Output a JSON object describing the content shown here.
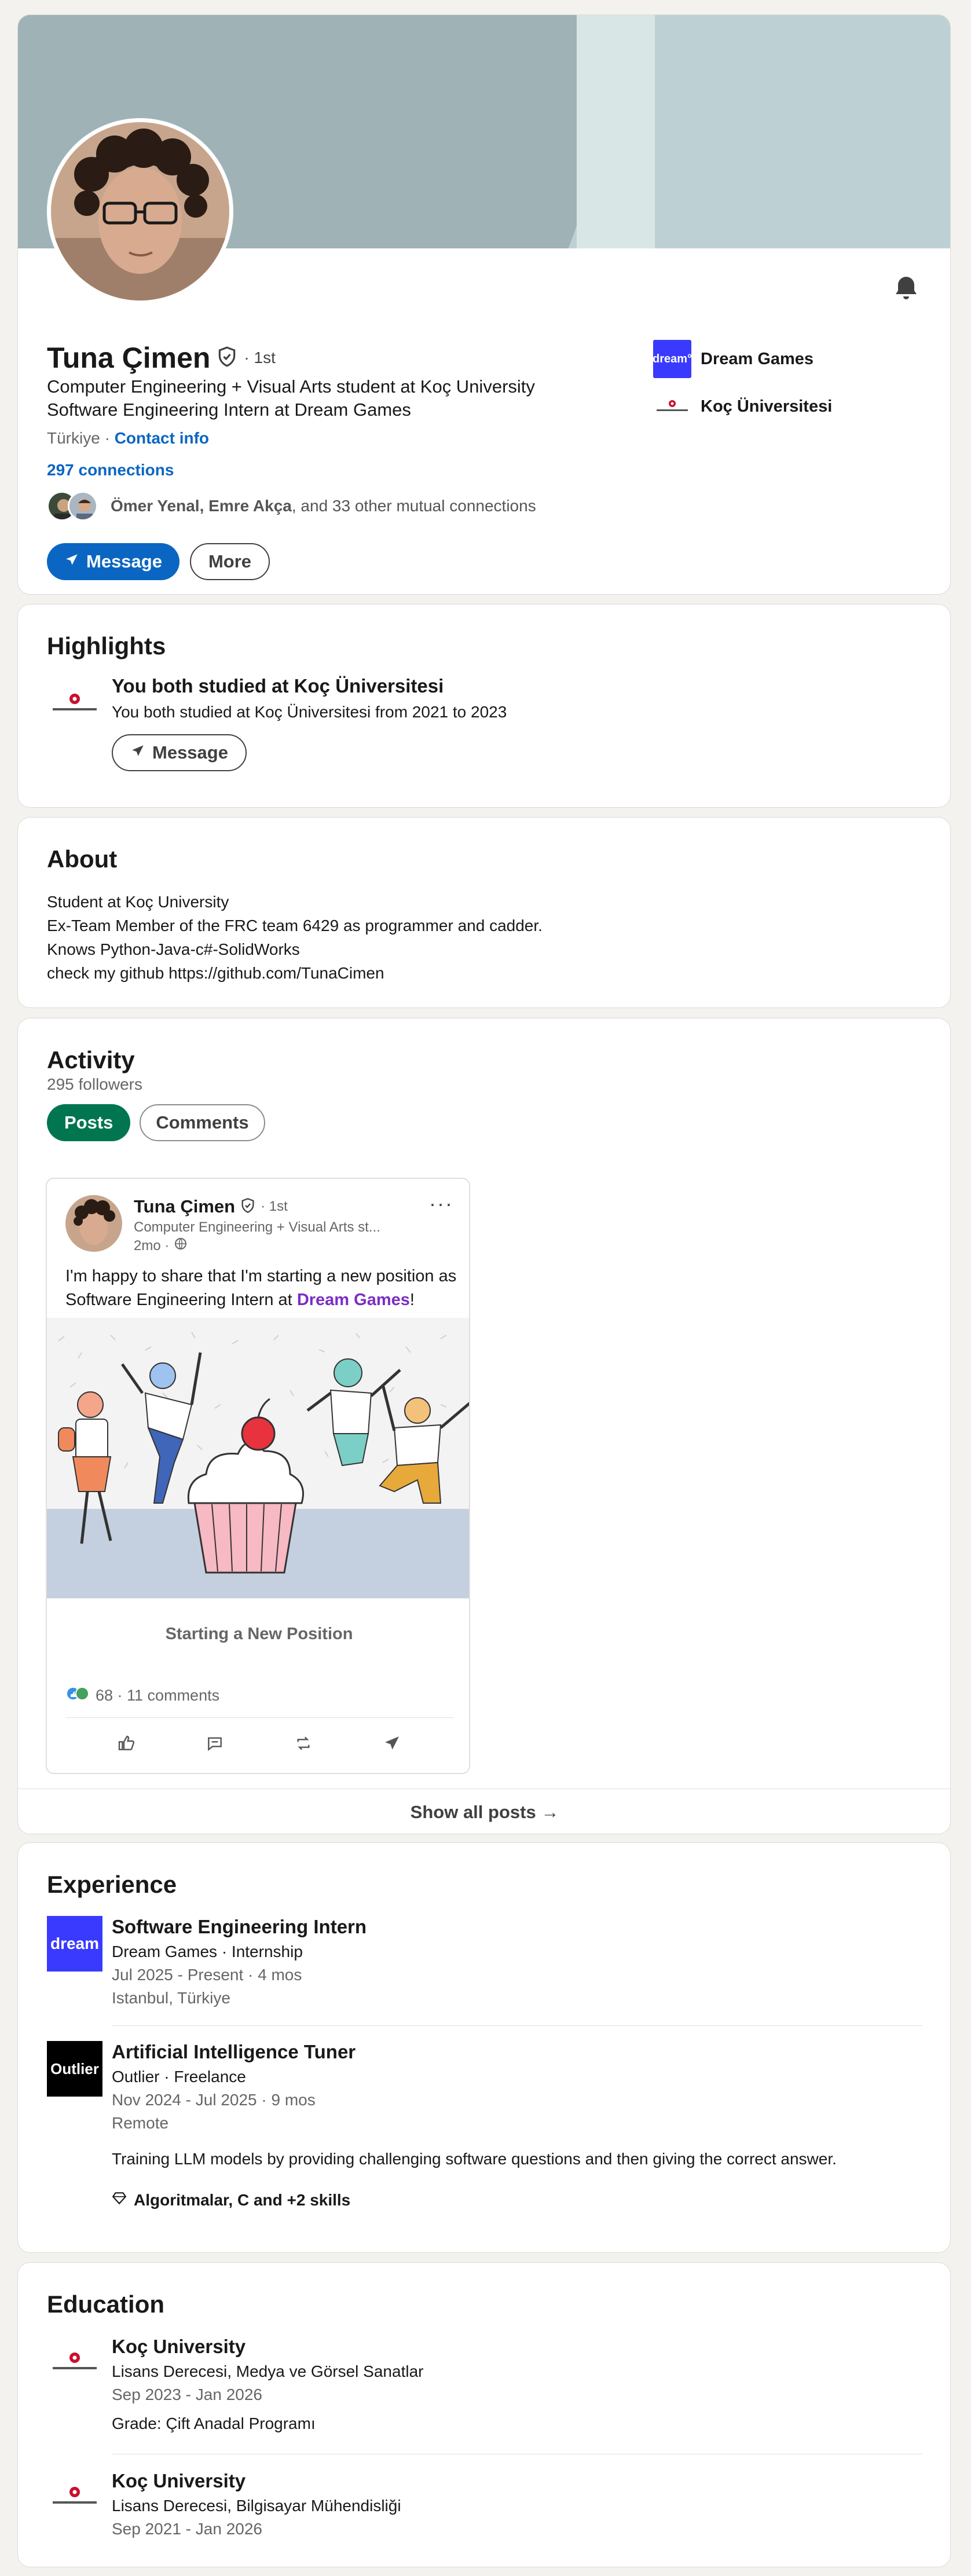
{
  "profile": {
    "name": "Tuna Çimen",
    "degree": "· 1st",
    "headline_line1": "Computer Engineering + Visual Arts student at Koç University",
    "headline_line2": "Software Engineering Intern at Dream Games",
    "location": "Türkiye ·",
    "contact_info": "Contact info",
    "connections": "297 connections",
    "mutual_name1": "Ömer Yenal",
    "mutual_sep": ",",
    "mutual_name2": "Emre Akça",
    "mutual_rest": ", and 33 other mutual connections",
    "message_btn": "Message",
    "more_btn": "More"
  },
  "companies": [
    {
      "logo": "dream",
      "name": "Dream Games"
    },
    {
      "logo": "koc",
      "name": "Koç Üniversitesi"
    }
  ],
  "highlights": {
    "title": "Highlights",
    "item_title": "You both studied at Koç Üniversitesi",
    "item_sub": "You both studied at Koç Üniversitesi from 2021 to 2023",
    "button": "Message"
  },
  "about": {
    "title": "About",
    "lines": [
      "Student at Koç University",
      "Ex-Team Member of the FRC team 6429 as programmer and cadder.",
      "Knows Python-Java-c#-SolidWorks",
      "check my github https://github.com/TunaCimen"
    ]
  },
  "activity": {
    "title": "Activity",
    "followers": "295 followers",
    "tab_posts": "Posts",
    "tab_comments": "Comments",
    "post": {
      "author": "Tuna Çimen",
      "degree": "· 1st",
      "headline": "Computer Engineering + Visual Arts st...",
      "time": "2mo ·",
      "text_before": "I'm happy to share that I'm starting a new position as Software Engineering Intern at ",
      "mention": "Dream Games",
      "text_after": "!",
      "caption": "Starting a New Position",
      "reactions": "68 · 11 comments"
    },
    "show_all": "Show all posts →"
  },
  "experience": {
    "title": "Experience",
    "items": [
      {
        "logo_text": "dream",
        "title": "Software Engineering Intern",
        "company": "Dream Games · Internship",
        "dates": "Jul 2025 - Present · 4 mos",
        "location": "Istanbul, Türkiye"
      },
      {
        "logo_text": "Outlier",
        "title": "Artificial Intelligence Tuner",
        "company": "Outlier · Freelance",
        "dates": "Nov 2024 - Jul 2025 · 9 mos",
        "location": "Remote",
        "description": "Training LLM models by providing challenging software questions and then giving the correct answer.",
        "skills": "Algoritmalar, C and +2 skills"
      }
    ]
  },
  "education": {
    "title": "Education",
    "items": [
      {
        "school": "Koç University",
        "degree": "Lisans Derecesi, Medya ve Görsel Sanatlar",
        "dates": "Sep 2023 - Jan 2026",
        "grade": "Grade: Çift Anadal Programı"
      },
      {
        "school": "Koç University",
        "degree": "Lisans Derecesi, Bilgisayar Mühendisliği",
        "dates": "Sep 2021 - Jan 2026"
      }
    ]
  },
  "colors": {
    "brand_blue": "#0a66c2",
    "green": "#01754f",
    "dream_blue": "#3a3aff",
    "mention_purple": "#7a2dc4"
  }
}
